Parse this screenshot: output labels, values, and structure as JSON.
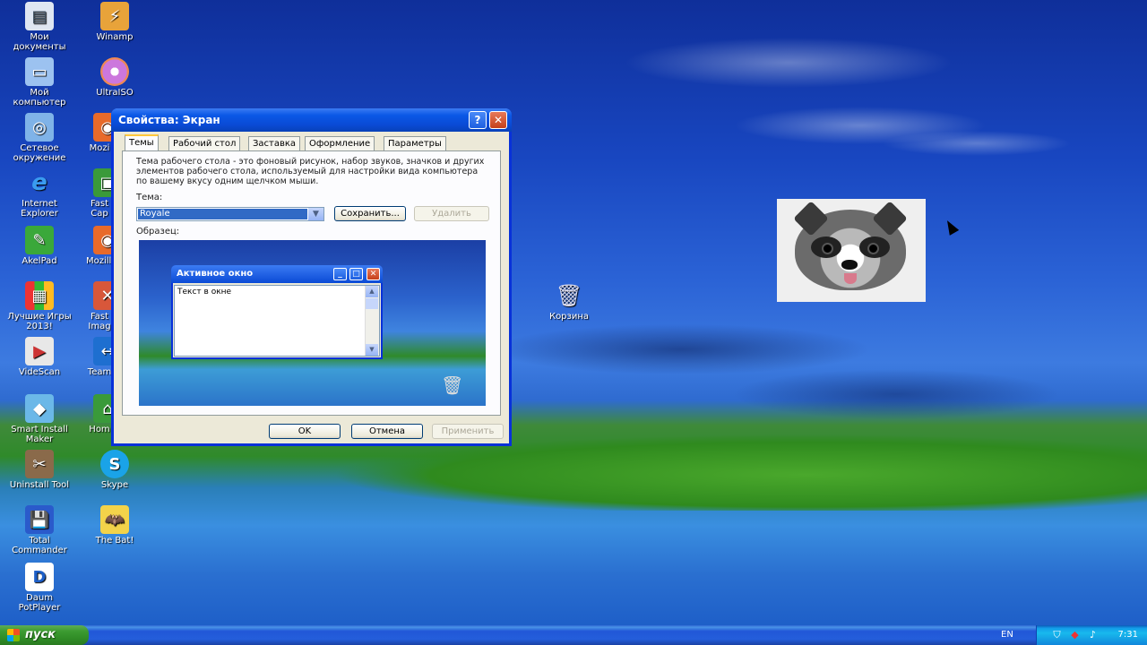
{
  "desktop": {
    "icons_col1": [
      {
        "label": "Мои\nдокументы",
        "icon": "my-documents-icon"
      },
      {
        "label": "Мой\nкомпьютер",
        "icon": "my-computer-icon"
      },
      {
        "label": "Сетевое\nокружение",
        "icon": "network-icon"
      },
      {
        "label": "Internet\nExplorer",
        "icon": "ie-icon"
      },
      {
        "label": "AkelPad",
        "icon": "akelpad-icon"
      },
      {
        "label": "Лучшие Игры\n2013!",
        "icon": "games-icon"
      },
      {
        "label": "VideScan",
        "icon": "videoscan-icon"
      },
      {
        "label": "Smart Install\nMaker",
        "icon": "smart-install-icon"
      },
      {
        "label": "Uninstall Tool",
        "icon": "uninstall-icon"
      },
      {
        "label": "Total\nCommander",
        "icon": "total-commander-icon"
      },
      {
        "label": "Daum\nPotPlayer",
        "icon": "potplayer-icon"
      }
    ],
    "icons_col2": [
      {
        "label": "Winamp",
        "icon": "winamp-icon"
      },
      {
        "label": "UltraISO",
        "icon": "ultraiso-icon"
      },
      {
        "label": "Mozi",
        "icon": "mozilla-icon"
      },
      {
        "label": "Fast\nCap",
        "icon": "faststone-icon"
      },
      {
        "label": "Mozilla",
        "icon": "mozilla-icon"
      },
      {
        "label": "Fast\nImag",
        "icon": "faststone-image-icon"
      },
      {
        "label": "Team",
        "icon": "teamviewer-icon"
      },
      {
        "label": "Hom",
        "icon": "home-icon"
      },
      {
        "label": "Skype",
        "icon": "skype-icon"
      },
      {
        "label": "The Bat!",
        "icon": "thebat-icon"
      }
    ],
    "recycle_bin": {
      "label": "Корзина",
      "icon": "recycle-bin-icon"
    }
  },
  "dialog": {
    "title": "Свойства: Экран",
    "help": "?",
    "close": "✕",
    "tabs": [
      "Темы",
      "Рабочий стол",
      "Заставка",
      "Оформление",
      "Параметры"
    ],
    "description": "Тема рабочего стола - это фоновый рисунок, набор звуков, значков и других элементов рабочего стола, используемый для настройки вида компьютера по вашему вкусу одним щелчком мыши.",
    "theme_label": "Тема:",
    "theme_value": "Royale",
    "save_button": "Сохранить...",
    "delete_button": "Удалить",
    "sample_label": "Образец:",
    "preview": {
      "window_title": "Активное окно",
      "window_text": "Текст в окне"
    },
    "ok_button": "OK",
    "cancel_button": "Отмена",
    "apply_button": "Применить"
  },
  "taskbar": {
    "start_label": "пуск",
    "language": "EN",
    "clock": "7:31"
  }
}
